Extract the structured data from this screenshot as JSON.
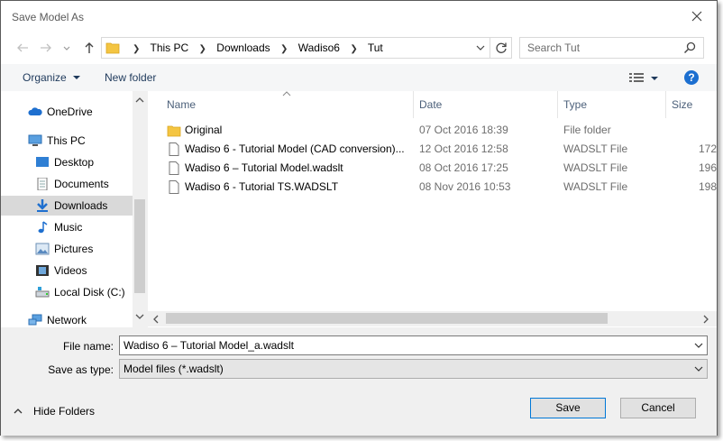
{
  "window": {
    "title": "Save Model As"
  },
  "address": {
    "crumbs": [
      "This PC",
      "Downloads",
      "Wadiso6",
      "Tut"
    ]
  },
  "search": {
    "placeholder": "Search Tut"
  },
  "toolbar": {
    "organize": "Organize",
    "new_folder": "New folder"
  },
  "sidebar": {
    "items": [
      {
        "label": "OneDrive",
        "icon": "cloud-icon"
      },
      {
        "label": "This PC",
        "icon": "computer-icon"
      },
      {
        "label": "Desktop",
        "icon": "desktop-icon"
      },
      {
        "label": "Documents",
        "icon": "documents-icon"
      },
      {
        "label": "Downloads",
        "icon": "download-icon",
        "selected": true
      },
      {
        "label": "Music",
        "icon": "music-icon"
      },
      {
        "label": "Pictures",
        "icon": "pictures-icon"
      },
      {
        "label": "Videos",
        "icon": "videos-icon"
      },
      {
        "label": "Local Disk (C:)",
        "icon": "disk-icon"
      },
      {
        "label": "Network",
        "icon": "network-icon"
      }
    ]
  },
  "columns": {
    "name": "Name",
    "date": "Date",
    "type": "Type",
    "size": "Size"
  },
  "files": [
    {
      "name": "Original",
      "date": "07 Oct 2016 18:39",
      "type": "File folder",
      "size": "",
      "icon": "folder-icon"
    },
    {
      "name": "Wadiso 6 - Tutorial Model  (CAD conversion)...",
      "date": "12 Oct 2016 12:58",
      "type": "WADSLT File",
      "size": "172",
      "icon": "file-icon"
    },
    {
      "name": "Wadiso 6 – Tutorial Model.wadslt",
      "date": "08 Oct 2016 17:25",
      "type": "WADSLT File",
      "size": "196",
      "icon": "file-icon"
    },
    {
      "name": "Wadiso 6 - Tutorial TS.WADSLT",
      "date": "08 Nov 2016 10:53",
      "type": "WADSLT File",
      "size": "198",
      "icon": "file-icon"
    }
  ],
  "form": {
    "filename_label": "File name:",
    "filename_value": "Wadiso 6 – Tutorial Model_a.wadslt",
    "savetype_label": "Save as type:",
    "savetype_value": "Model files (*.wadslt)"
  },
  "footer": {
    "hide_folders": "Hide Folders",
    "save": "Save",
    "cancel": "Cancel"
  },
  "colors": {
    "accent": "#0078d7",
    "help": "#1c6fd0",
    "folder": "#f4c542"
  }
}
